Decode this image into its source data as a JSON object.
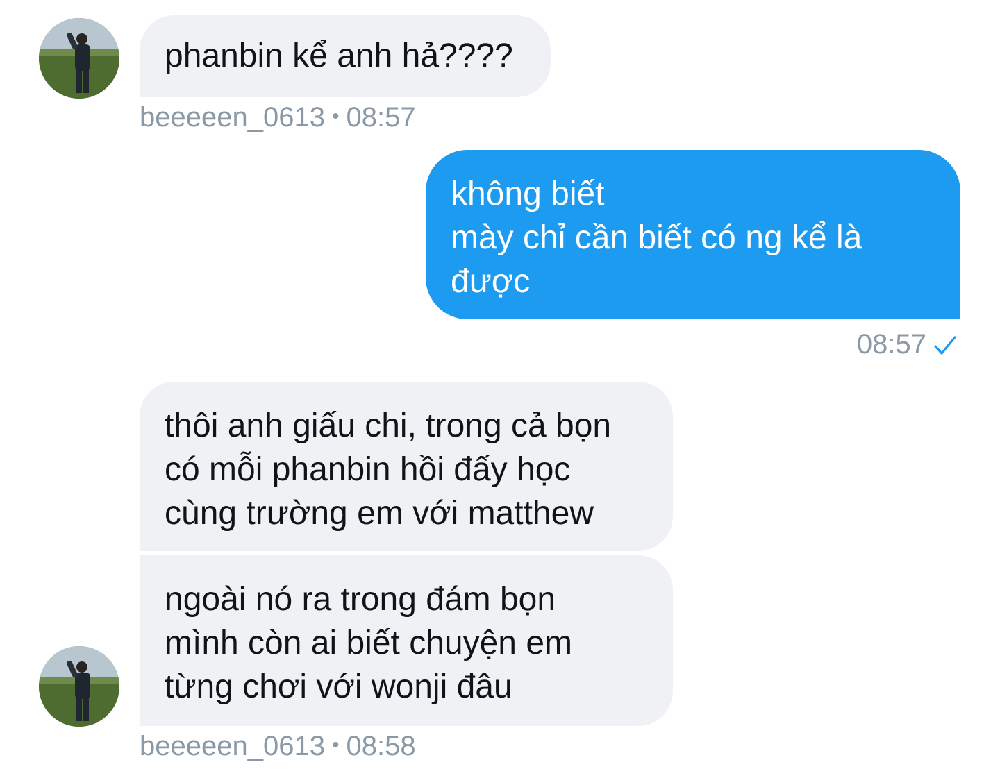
{
  "messages": [
    {
      "direction": "incoming",
      "text": "phanbin kể anh hả????",
      "sender": "beeeeen_0613",
      "time": "08:57"
    },
    {
      "direction": "outgoing",
      "text": "không biết\nmày chỉ cần biết có ng kể là\nđược",
      "time": "08:57",
      "status_icon": "check-icon"
    },
    {
      "direction": "incoming",
      "text": "thôi anh giấu chi, trong cả bọn\ncó mỗi phanbin hồi đấy học\ncùng trường em với matthew"
    },
    {
      "direction": "incoming",
      "text": "ngoài nó ra trong đám bọn\nmình còn ai biết chuyện em\ntừng chơi với wonji đâu",
      "sender": "beeeeen_0613",
      "time": "08:58"
    }
  ],
  "meta_separator": "•",
  "colors": {
    "incoming_bubble": "#eff1f4",
    "outgoing_bubble": "#1d9bf0",
    "meta_text": "#8b98a5",
    "check": "#1d9bf0"
  }
}
